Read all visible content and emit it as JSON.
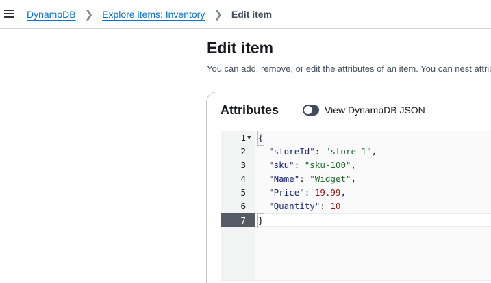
{
  "breadcrumb": {
    "items": [
      "DynamoDB",
      "Explore items: Inventory"
    ],
    "current": "Edit item"
  },
  "page": {
    "title": "Edit item",
    "description": "You can add, remove, or edit the attributes of an item. You can nest attributes"
  },
  "attributes": {
    "title": "Attributes",
    "toggle_label": "View DynamoDB JSON",
    "toggle_on": false
  },
  "editor": {
    "active_line": 7,
    "lines": [
      {
        "num": "1",
        "open": "{"
      },
      {
        "num": "2",
        "key": "\"storeId\"",
        "value": "\"store-1\"",
        "type": "string",
        "comma": ","
      },
      {
        "num": "3",
        "key": "\"sku\"",
        "value": "\"sku-100\"",
        "type": "string",
        "comma": ","
      },
      {
        "num": "4",
        "key": "\"Name\"",
        "value": "\"Widget\"",
        "type": "string",
        "comma": ","
      },
      {
        "num": "5",
        "key": "\"Price\"",
        "value": "19.99",
        "type": "number",
        "comma": ","
      },
      {
        "num": "6",
        "key": "\"Quantity\"",
        "value": "10",
        "type": "number",
        "comma": ""
      },
      {
        "num": "7",
        "close": "}"
      }
    ]
  },
  "colors": {
    "link": "#0972d3",
    "key": "#1a237e",
    "string": "#1e6b2d",
    "number": "#a31515"
  }
}
